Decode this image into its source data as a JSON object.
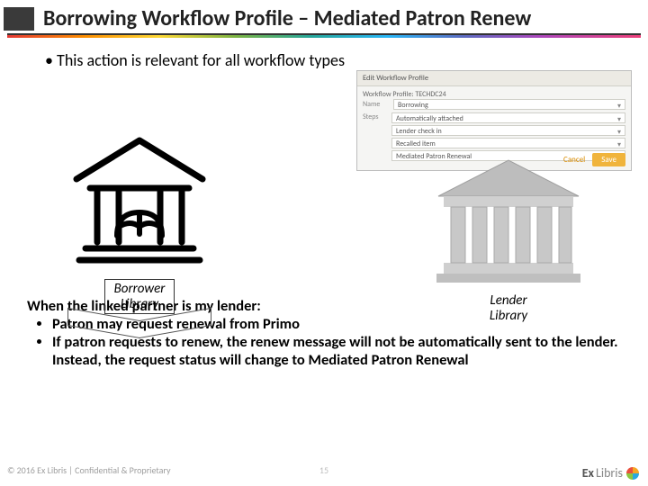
{
  "title": "Borrowing Workflow Profile – Mediated Patron Renew",
  "top_bullet": "This action is relevant for all workflow types",
  "panel": {
    "header": "Edit Workflow Profile",
    "subheader": "Workflow Profile: TECHDC24",
    "field_name_label": "Name",
    "field_name_value": "Borrowing",
    "field_steps_label": "Steps",
    "steps": [
      "Automatically attached",
      "Lender check in",
      "Recalled item",
      "Mediated Patron Renewal"
    ],
    "cancel": "Cancel",
    "save": "Save"
  },
  "borrower_caption_l1": "Borrower",
  "borrower_caption_l2": "Library",
  "lender_caption_l1": "Lender",
  "lender_caption_l2": "Library",
  "lead": "When the linked partner is my lender:",
  "bullets": [
    "Patron may request renewal from Primo",
    "If patron requests to renew, the renew message will not be automatically sent to the lender.  Instead, the request status will change to Mediated Patron Renewal"
  ],
  "footer_copy": "© 2016 Ex Libris | Confidential & Proprietary",
  "page_number": "15",
  "logo_ex": "Ex",
  "logo_libris": "Libris"
}
